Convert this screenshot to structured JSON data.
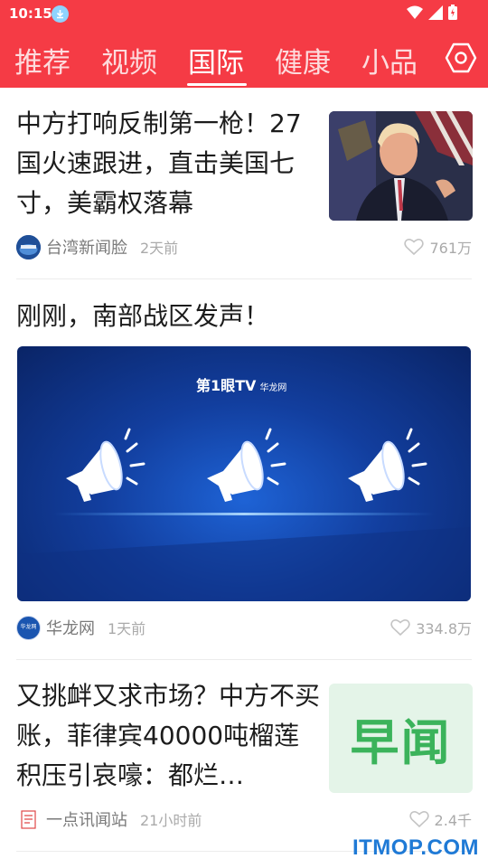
{
  "status": {
    "time": "10:15"
  },
  "tabs": [
    {
      "label": "推荐"
    },
    {
      "label": "视频"
    },
    {
      "label": "国际"
    },
    {
      "label": "健康"
    },
    {
      "label": "小品"
    }
  ],
  "articles": [
    {
      "title": "中方打响反制第一枪！27国火速跟进，直击美国七寸，美霸权落幕",
      "source": "台湾新闻脸",
      "time": "2天前",
      "likes": "761万"
    },
    {
      "title": "刚刚，南部战区发声！",
      "source": "华龙网",
      "time": "1天前",
      "likes": "334.8万",
      "video_brand": "第1眼TV",
      "video_brand_sub": "华龙网",
      "avatar_text": "华龙网"
    },
    {
      "title": "又挑衅又求市场？中方不买账，菲律宾40000吨榴莲积压引哀嚎：都烂…",
      "source": "一点讯闻站",
      "time": "21小时前",
      "likes": "2.4千",
      "thumb_text": "早闻"
    }
  ],
  "watermark": "ITMOP.COM",
  "colors": {
    "accent": "#f53b45"
  }
}
